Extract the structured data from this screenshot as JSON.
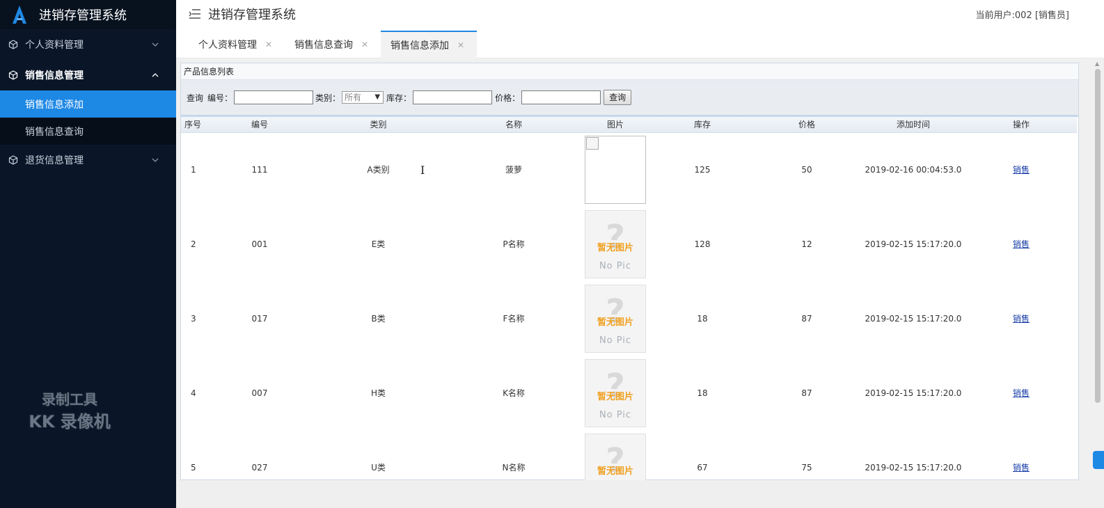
{
  "sidebar": {
    "app_title": "进销存管理系统",
    "menus": [
      {
        "label": "个人资料管理",
        "open": false
      },
      {
        "label": "销售信息管理",
        "open": true,
        "children": [
          {
            "label": "销售信息添加",
            "active": true
          },
          {
            "label": "销售信息查询",
            "active": false
          }
        ]
      },
      {
        "label": "退货信息管理",
        "open": false
      }
    ],
    "watermark_line1": "录制工具",
    "watermark_line2": "KK 录像机"
  },
  "header": {
    "title": "进销存管理系统",
    "current_user": "当前用户:002 [销售员]"
  },
  "tabs": [
    {
      "label": "个人资料管理",
      "active": false
    },
    {
      "label": "销售信息查询",
      "active": false
    },
    {
      "label": "销售信息添加",
      "active": true
    }
  ],
  "panel": {
    "title": "产品信息列表",
    "search": {
      "prefix": "查询",
      "code_label": "编号：",
      "category_label": "类别：",
      "category_value": "所有",
      "stock_label": "库存：",
      "price_label": "价格：",
      "button": "查询"
    },
    "columns": [
      "序号",
      "编号",
      "类别",
      "名称",
      "图片",
      "库存",
      "价格",
      "添加时间",
      "操作"
    ],
    "rows": [
      {
        "seq": "1",
        "code": "111",
        "category": "A类别",
        "name": "菠萝",
        "pic": "broken",
        "stock": "125",
        "price": "50",
        "time": "2019-02-16 00:04:53.0",
        "action": "销售"
      },
      {
        "seq": "2",
        "code": "001",
        "category": "E类",
        "name": "P名称",
        "pic": "nopic",
        "stock": "128",
        "price": "12",
        "time": "2019-02-15 15:17:20.0",
        "action": "销售"
      },
      {
        "seq": "3",
        "code": "017",
        "category": "B类",
        "name": "F名称",
        "pic": "nopic",
        "stock": "18",
        "price": "87",
        "time": "2019-02-15 15:17:20.0",
        "action": "销售"
      },
      {
        "seq": "4",
        "code": "007",
        "category": "H类",
        "name": "K名称",
        "pic": "nopic",
        "stock": "18",
        "price": "87",
        "time": "2019-02-15 15:17:20.0",
        "action": "销售"
      },
      {
        "seq": "5",
        "code": "027",
        "category": "U类",
        "name": "N名称",
        "pic": "nopic",
        "stock": "67",
        "price": "75",
        "time": "2019-02-15 15:17:20.0",
        "action": "销售"
      }
    ],
    "nopic_cn": "暂无图片",
    "nopic_en": "No Pic"
  },
  "colors": {
    "sidebar_bg": "#0a1628",
    "accent": "#1e88e5",
    "link": "#1a3ea8",
    "nopic_text": "#f0a020"
  }
}
